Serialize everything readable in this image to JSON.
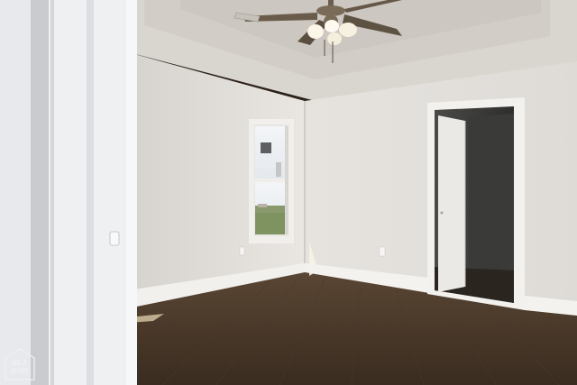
{
  "watermark": {
    "line1": "NEA",
    "line2": "BOR"
  }
}
